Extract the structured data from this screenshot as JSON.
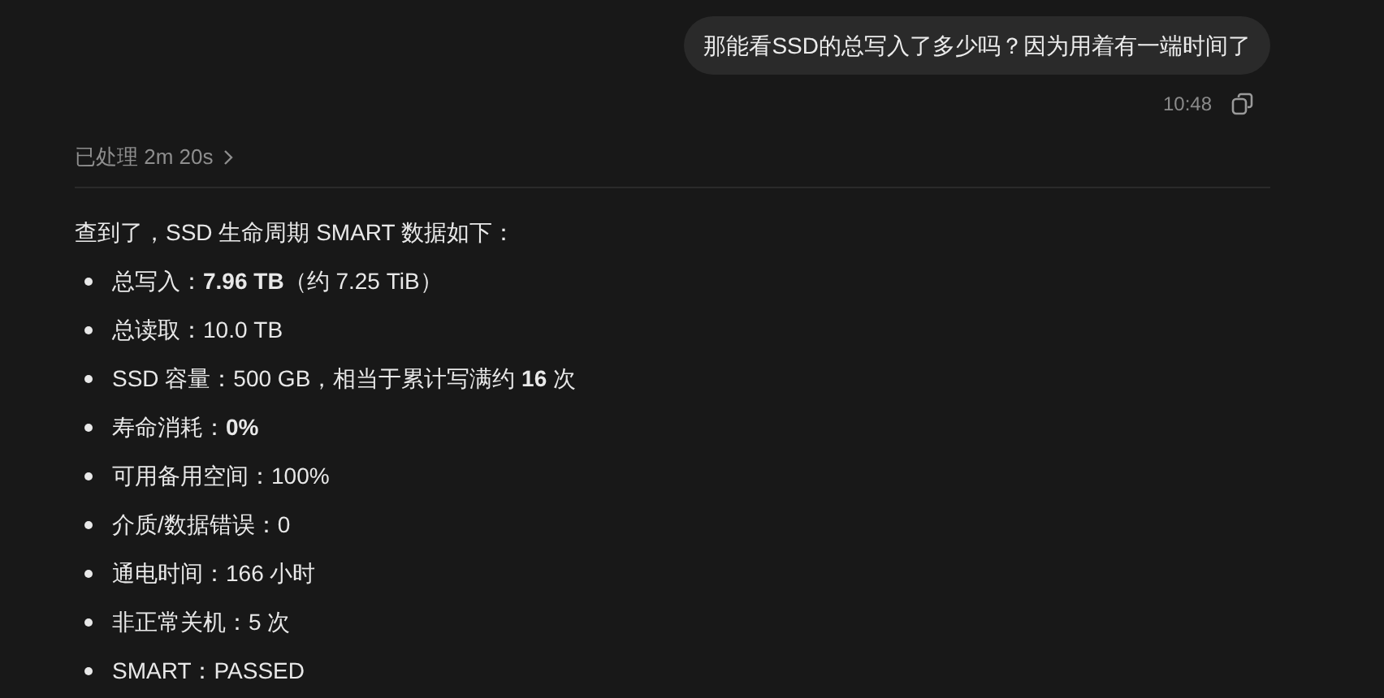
{
  "user_message": {
    "text": "那能看SSD的总写入了多少吗？因为用着有一端时间了",
    "time": "10:48"
  },
  "processed": {
    "label": "已处理 2m 20s"
  },
  "reply": {
    "intro": "查到了，SSD 生命周期 SMART 数据如下：",
    "items": [
      "总写入：**7.96 TB**（约 7.25 TiB）",
      "总读取：10.0 TB",
      "SSD 容量：500 GB，相当于累计写满约 **16** 次",
      "寿命消耗：**0%**",
      "可用备用空间：100%",
      "介质/数据错误：0",
      "通电时间：166 小时",
      "非正常关机：5 次",
      "SMART：PASSED"
    ]
  }
}
